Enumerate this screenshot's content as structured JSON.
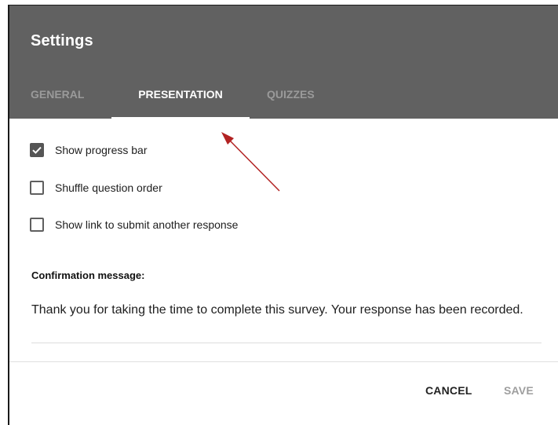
{
  "dialog": {
    "title": "Settings",
    "tabs": [
      {
        "label": "GENERAL",
        "active": false
      },
      {
        "label": "PRESENTATION",
        "active": true
      },
      {
        "label": "QUIZZES",
        "active": false
      }
    ],
    "options": [
      {
        "label": "Show progress bar",
        "checked": true
      },
      {
        "label": "Shuffle question order",
        "checked": false
      },
      {
        "label": "Show link to submit another response",
        "checked": false
      }
    ],
    "confirmation": {
      "label": "Confirmation message:",
      "text": "Thank you for taking the time to complete this survey. Your response has been recorded."
    },
    "buttons": {
      "cancel": "CANCEL",
      "save": "SAVE"
    }
  },
  "colors": {
    "header_bg": "#616161",
    "annotation_arrow": "#b22222",
    "checkbox_checked": "#555555"
  },
  "icons": {
    "checkmark": "check-icon",
    "annotation": "arrow-annotation-icon"
  }
}
